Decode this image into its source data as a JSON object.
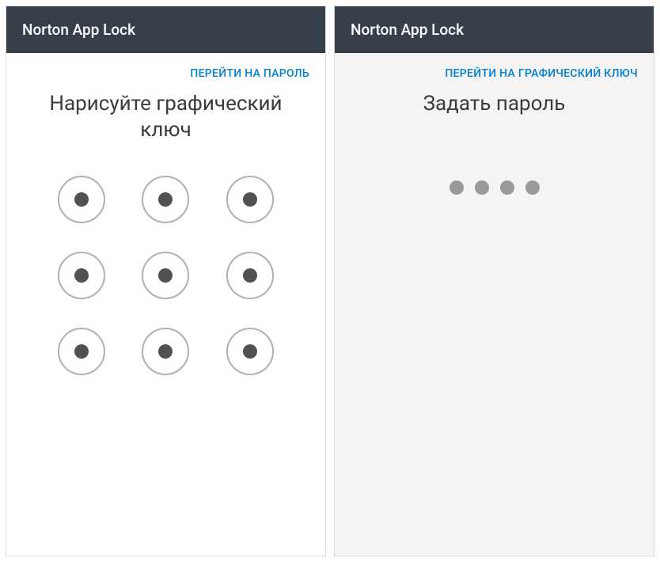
{
  "left": {
    "header": "Norton App Lock",
    "switchLink": "ПЕРЕЙТИ НА ПАРОЛЬ",
    "instruction": "Нарисуйте графический ключ",
    "patternNodeCount": 9
  },
  "right": {
    "header": "Norton App Lock",
    "switchLink": "ПЕРЕЙТИ НА ГРАФИЧЕСКИЙ КЛЮЧ",
    "instruction": "Задать пароль",
    "pinDotCount": 4
  }
}
